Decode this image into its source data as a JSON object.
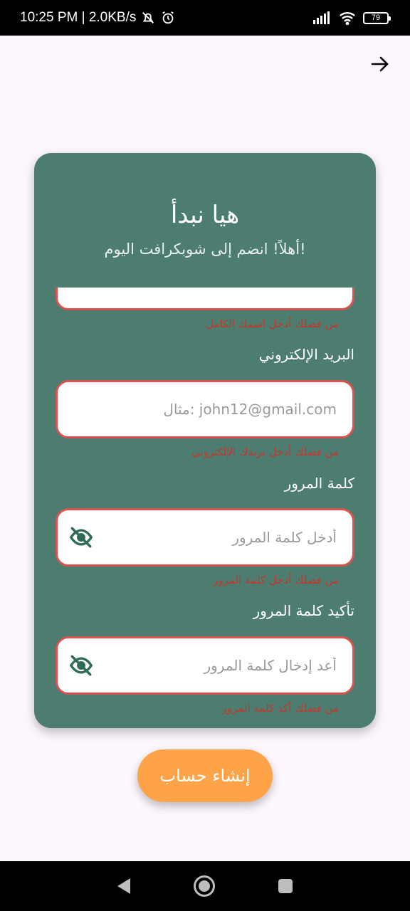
{
  "status_bar": {
    "time_info": "10:25 PM | 2.0KB/s",
    "battery": "79"
  },
  "header": {
    "title": "هيا نبدأ",
    "subtitle": "أهلاً! انضم إلى شوبكرافت اليوم!"
  },
  "form": {
    "name_error": "من فضلك أدخل اسمك الكامل",
    "email": {
      "label": "البريد الإلكتروني",
      "placeholder": "مثال: john12@gmail.com",
      "error": "من فضلك أدخل بريدك الإلكتروني"
    },
    "password": {
      "label": "كلمة المرور",
      "placeholder": "أدخل كلمة المرور",
      "error": "من فضلك أدخل كلمة المرور"
    },
    "confirm_password": {
      "label": "تأكيد كلمة المرور",
      "placeholder": "أعد إدخال كلمة المرور",
      "error": "من فضلك أكد كلمة المرور"
    }
  },
  "submit_label": "إنشاء حساب",
  "colors": {
    "card": "#4d7c70",
    "accent": "#ffa348",
    "error": "#d9534f",
    "icon": "#2e6b58"
  }
}
